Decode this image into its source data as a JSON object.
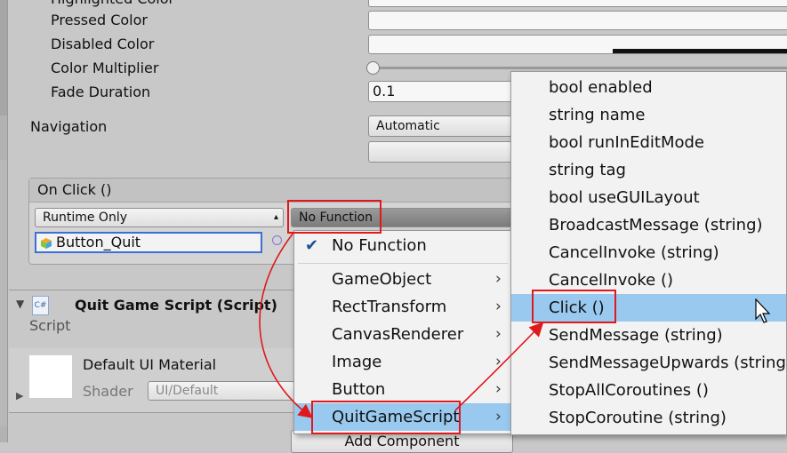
{
  "inspector": {
    "props": {
      "highlighted": "Highlighted Color",
      "pressed": "Pressed Color",
      "disabled": "Disabled Color",
      "multiplier": "Color Multiplier",
      "fade": "Fade Duration",
      "fade_value": "0.1",
      "navigation": "Navigation",
      "navigation_value": "Automatic"
    },
    "on_click": {
      "header": "On Click ()",
      "runtime": "Runtime Only",
      "function": "No Function",
      "object": "Button_Quit"
    },
    "script": {
      "title": "Quit Game Script (Script)",
      "label": "Script",
      "icon_text": "C#"
    },
    "material": {
      "name": "Default UI Material",
      "shader_label": "Shader",
      "shader_value": "UI/Default"
    },
    "add_component": "Add Component"
  },
  "menu1": {
    "checked": "No Function",
    "items": [
      "GameObject",
      "RectTransform",
      "CanvasRenderer",
      "Image",
      "Button",
      "QuitGameScript"
    ]
  },
  "menu2": {
    "items": [
      "bool enabled",
      "string name",
      "bool runInEditMode",
      "string tag",
      "bool useGUILayout",
      "BroadcastMessage (string)",
      "CancelInvoke (string)",
      "CancelInvoke ()",
      "Click ()",
      "SendMessage (string)",
      "SendMessageUpwards (string)",
      "StopAllCoroutines ()",
      "StopCoroutine (string)"
    ]
  },
  "colors": {
    "highlight": "#99c9ef",
    "annotation_red": "#e0191d"
  }
}
